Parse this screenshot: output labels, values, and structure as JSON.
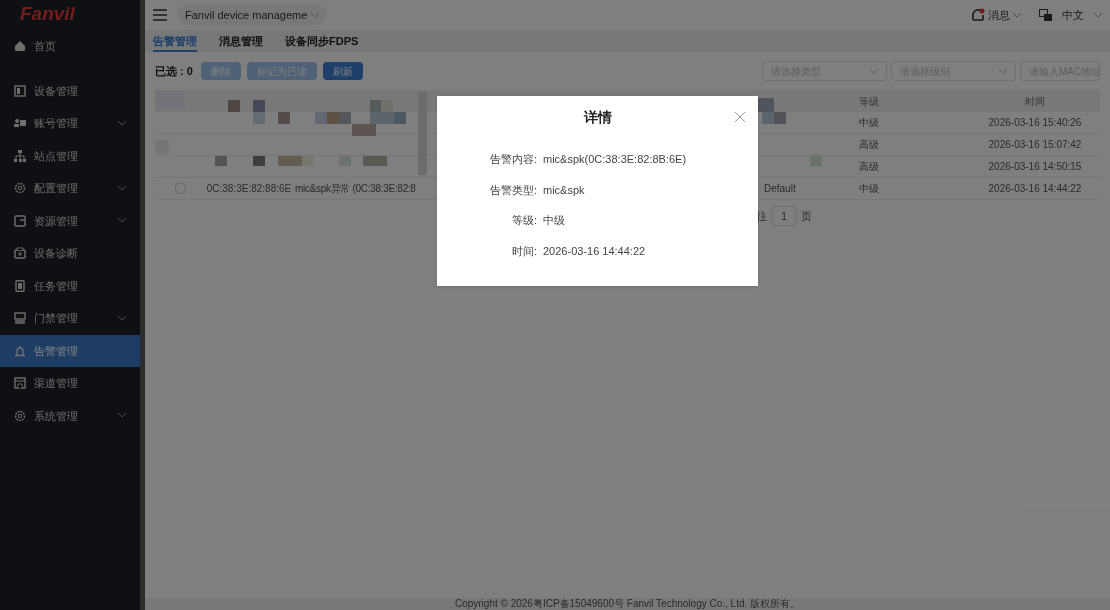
{
  "sidebar": {
    "logo": "Fanvil",
    "items": [
      {
        "label": "首页",
        "kind": "link",
        "selected": false
      },
      {
        "label": "设备管理",
        "kind": "link",
        "selected": false
      },
      {
        "label": "账号管理",
        "kind": "group",
        "selected": false
      },
      {
        "label": "站点管理",
        "kind": "link",
        "selected": false
      },
      {
        "label": "配置管理",
        "kind": "group",
        "selected": false
      },
      {
        "label": "资源管理",
        "kind": "group",
        "selected": false
      },
      {
        "label": "设备诊断",
        "kind": "link",
        "selected": false
      },
      {
        "label": "任务管理",
        "kind": "link",
        "selected": false
      },
      {
        "label": "门禁管理",
        "kind": "group",
        "selected": false
      },
      {
        "label": "告警管理",
        "kind": "link",
        "selected": true
      },
      {
        "label": "渠道管理",
        "kind": "link",
        "selected": false
      },
      {
        "label": "系统管理",
        "kind": "group",
        "selected": false
      }
    ]
  },
  "topbar": {
    "breadcrumb": "Fanvil device manageme",
    "messages": "消息",
    "language": "中文"
  },
  "tabs": [
    {
      "label": "告警管理",
      "selected": true
    },
    {
      "label": "消息管理",
      "selected": false
    },
    {
      "label": "设备同步FDPS",
      "selected": false
    }
  ],
  "toolbar": {
    "selected_count": "已选 : 0",
    "buttons": [
      {
        "label": "删除",
        "disabled": true
      },
      {
        "label": "标记为已读",
        "disabled": true
      },
      {
        "label": "刷新",
        "disabled": false
      }
    ],
    "filters": [
      {
        "kind": "select",
        "placeholder": "请选择类型"
      },
      {
        "kind": "select",
        "placeholder": "请选择级别"
      },
      {
        "kind": "input",
        "placeholder": "请输入MAC地址"
      }
    ]
  },
  "table": {
    "columns": [
      "",
      "",
      "",
      "",
      "等级",
      "时间"
    ],
    "rows": [
      {
        "cells": [
          "",
          "",
          "",
          "",
          "中级",
          "2026-03-16 15:40:26"
        ]
      },
      {
        "cells": [
          "",
          "",
          "",
          "",
          "高级",
          "2026-03-16 15:07:42"
        ]
      },
      {
        "cells": [
          "",
          "",
          "",
          "",
          "高级",
          "2026-03-16 14:50:15"
        ]
      },
      {
        "cells": [
          "",
          "0C:38:3E:82:88:6E",
          "mic&spk异常 (0C:38:3E:82:8",
          "Default",
          "中级",
          "2026-03-16 14:44:22"
        ],
        "checked": false
      }
    ]
  },
  "pagination": {
    "goto": "往",
    "page": "1",
    "unit": "页"
  },
  "footer": "Copyright © 2026粤ICP备15049600号 Fanvil Technology Co., Ltd. 版权所有。",
  "modal": {
    "title": "详情",
    "fields": [
      {
        "label": "告警内容:",
        "value": "mic&spk(0C:38:3E:82:8B:6E)"
      },
      {
        "label": "告警类型:",
        "value": "mic&spk"
      },
      {
        "label": "等级:",
        "value": "中级"
      },
      {
        "label": "时间:",
        "value": "2026-03-16 14:44:22"
      }
    ]
  }
}
